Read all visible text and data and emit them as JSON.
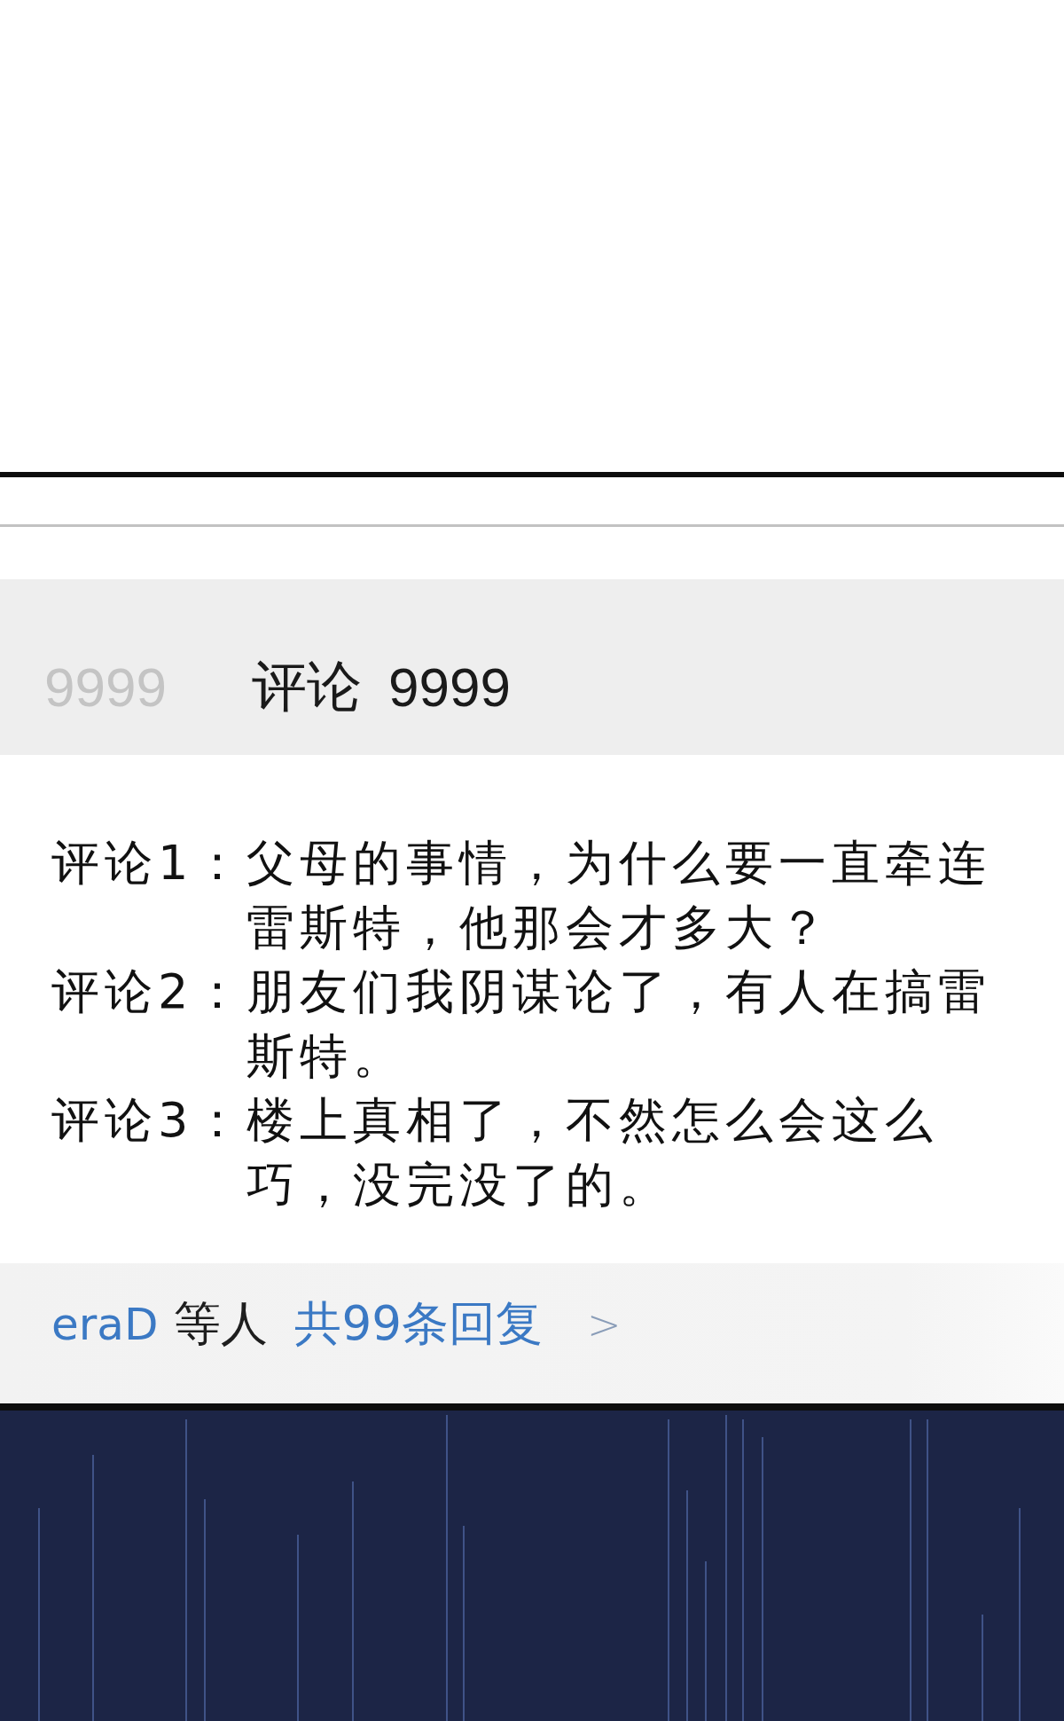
{
  "header": {
    "side_count": "9999",
    "label": "评论",
    "count": "9999"
  },
  "comments": [
    {
      "label": "评论1：",
      "text": "父母的事情，为什么要一直牵连雷斯特，他那会才多大？"
    },
    {
      "label": "评论2：",
      "text": "朋友们我阴谋论了，有人在搞雷斯特。"
    },
    {
      "label": "评论3：",
      "text": "楼上真相了，不然怎么会这么巧，没完没了的。"
    }
  ],
  "footer": {
    "user": "eraD",
    "suffix": "等人",
    "replies": "共99条回复",
    "arrow": ">"
  }
}
